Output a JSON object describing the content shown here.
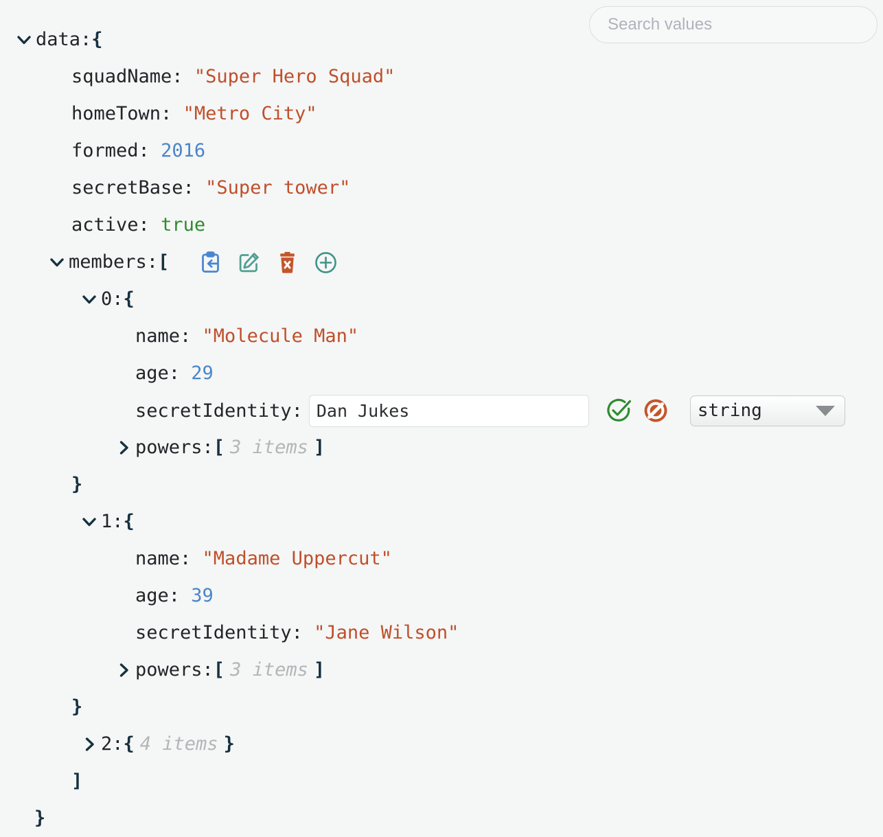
{
  "search": {
    "placeholder": "Search values",
    "value": ""
  },
  "tree": {
    "root_key": "data:",
    "open_brace": "{",
    "close_brace": "}",
    "open_bracket": "[",
    "close_bracket": "]",
    "fields": {
      "squadName_key": "squadName:",
      "squadName_value": "\"Super Hero Squad\"",
      "homeTown_key": "homeTown:",
      "homeTown_value": "\"Metro City\"",
      "formed_key": "formed:",
      "formed_value": "2016",
      "secretBase_key": "secretBase:",
      "secretBase_value": "\"Super tower\"",
      "active_key": "active:",
      "active_value": "true",
      "members_key": "members:"
    },
    "member0": {
      "index_key": "0:",
      "name_key": "name:",
      "name_value": "\"Molecule Man\"",
      "age_key": "age:",
      "age_value": "29",
      "secretIdentity_key": "secretIdentity:",
      "powers_key": "powers:",
      "powers_count": "3 items"
    },
    "member1": {
      "index_key": "1:",
      "name_key": "name:",
      "name_value": "\"Madame Uppercut\"",
      "age_key": "age:",
      "age_value": "39",
      "secretIdentity_key": "secretIdentity:",
      "secretIdentity_value": "\"Jane Wilson\"",
      "powers_key": "powers:",
      "powers_count": "3 items"
    },
    "member2": {
      "index_key": "2:",
      "items_count": "4 items"
    }
  },
  "editor": {
    "label": "secretIdentity:",
    "input_value": "Dan Jukes",
    "input_placeholder": "",
    "confirm_icon": "check-circle-icon",
    "cancel_icon": "ban-circle-icon",
    "type_value": "string"
  },
  "toolbar": {
    "paste_icon": "clipboard-paste-icon",
    "edit_icon": "edit-square-icon",
    "delete_icon": "trash-x-icon",
    "add_icon": "plus-circle-icon"
  },
  "colors": {
    "background": "#f5f6f6",
    "string": "#bf4f2a",
    "number": "#4a86c8",
    "boolean": "#2e8b2e",
    "punctuation": "#16313f",
    "key": "#222528",
    "count": "#b3b6b8",
    "paste": "#4a86d0",
    "edit": "#4f9e91",
    "delete": "#c4562a",
    "add": "#3f9387",
    "confirm": "#2e8b2e",
    "cancel": "#c4562a"
  }
}
